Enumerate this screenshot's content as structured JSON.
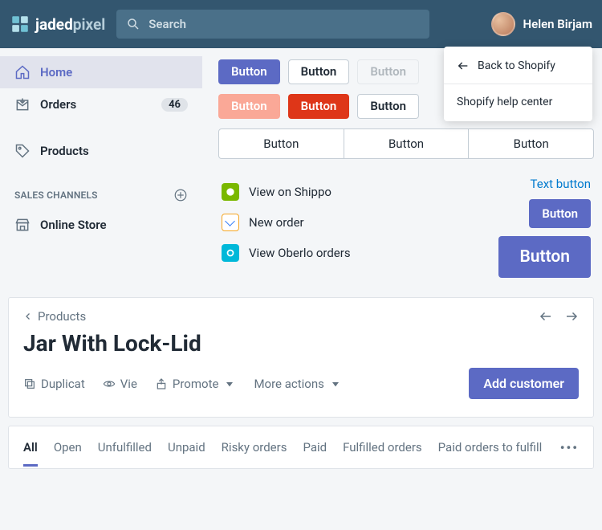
{
  "topbar": {
    "logo_strong": "jaded",
    "logo_light": "pixel",
    "search_placeholder": "Search",
    "user_name": "Helen Birjam"
  },
  "dropdown": {
    "back": "Back to Shopify",
    "help": "Shopify help center"
  },
  "sidebar": {
    "home": "Home",
    "orders": "Orders",
    "orders_badge": "46",
    "products": "Products",
    "section": "SALES CHANNELS",
    "online_store": "Online Store"
  },
  "buttons": {
    "row1": [
      "Button",
      "Button",
      "Button"
    ],
    "row2": [
      "Button",
      "Button",
      "Button"
    ],
    "segment": [
      "Button",
      "Button",
      "Button"
    ],
    "text_button": "Text button",
    "med": "Button",
    "large": "Button"
  },
  "actions": {
    "shippo": "View on Shippo",
    "new_order": "New order",
    "oberlo": "View Oberlo orders"
  },
  "detail": {
    "breadcrumb": "Products",
    "title": "Jar With Lock-Lid",
    "duplicate": "Duplicat",
    "view": "Vie",
    "promote": "Promote",
    "more": "More actions",
    "add_customer": "Add customer"
  },
  "tabs": [
    "All",
    "Open",
    "Unfulfilled",
    "Unpaid",
    "Risky orders",
    "Paid",
    "Fulfilled orders",
    "Paid orders to fulfill"
  ]
}
